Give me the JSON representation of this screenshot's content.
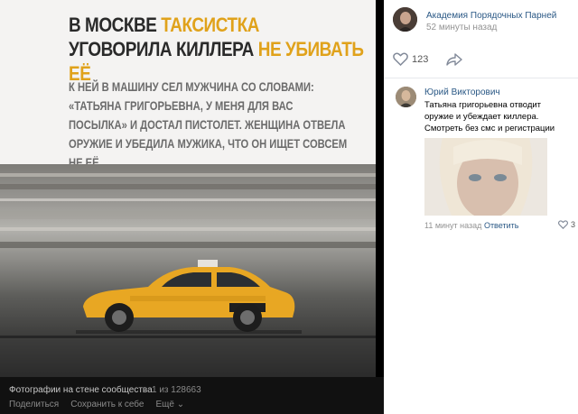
{
  "photo": {
    "headline_part1": "В МОСКВЕ ",
    "headline_accent1": "ТАКСИСТКА",
    "headline_part2": " УГОВОРИЛА КИЛЛЕРА ",
    "headline_accent2": "НЕ УБИВАТЬ ЕЁ",
    "subtext": "К НЕЙ В МАШИНУ СЕЛ МУЖЧИНА СО СЛОВАМИ: «ТАТЬЯНА ГРИГОРЬЕВНА, У МЕНЯ ДЛЯ ВАС ПОСЫЛКА» И ДОСТАЛ ПИСТОЛЕТ. ЖЕНЩИНА ОТВЕЛА ОРУЖИЕ И УБЕДИЛА МУЖИКА, ЧТО ОН ИЩЕТ СОВСЕМ НЕ ЕЁ",
    "accent_color": "#e0a21b"
  },
  "viewer_footer": {
    "title": "Фотографии на стене сообщества",
    "count": "1 из 128663",
    "share": "Поделиться",
    "save": "Сохранить к себе",
    "more": "Ещё"
  },
  "post": {
    "author": "Академия Порядочных Парней",
    "time": "52 минуты назад",
    "likes": "123"
  },
  "comment": {
    "author": "Юрий Викторович",
    "text": "Татьяна григорьевна отводит оружие и убеждает киллера. Смотреть без смс и регистрации",
    "time": "11 минут назад",
    "reply": "Ответить",
    "likes": "3"
  },
  "colors": {
    "link": "#2a5885",
    "meta": "#939393",
    "viewer_bg": "#000000"
  },
  "icons": [
    "heart-icon",
    "share-icon",
    "chevron-down-icon"
  ]
}
